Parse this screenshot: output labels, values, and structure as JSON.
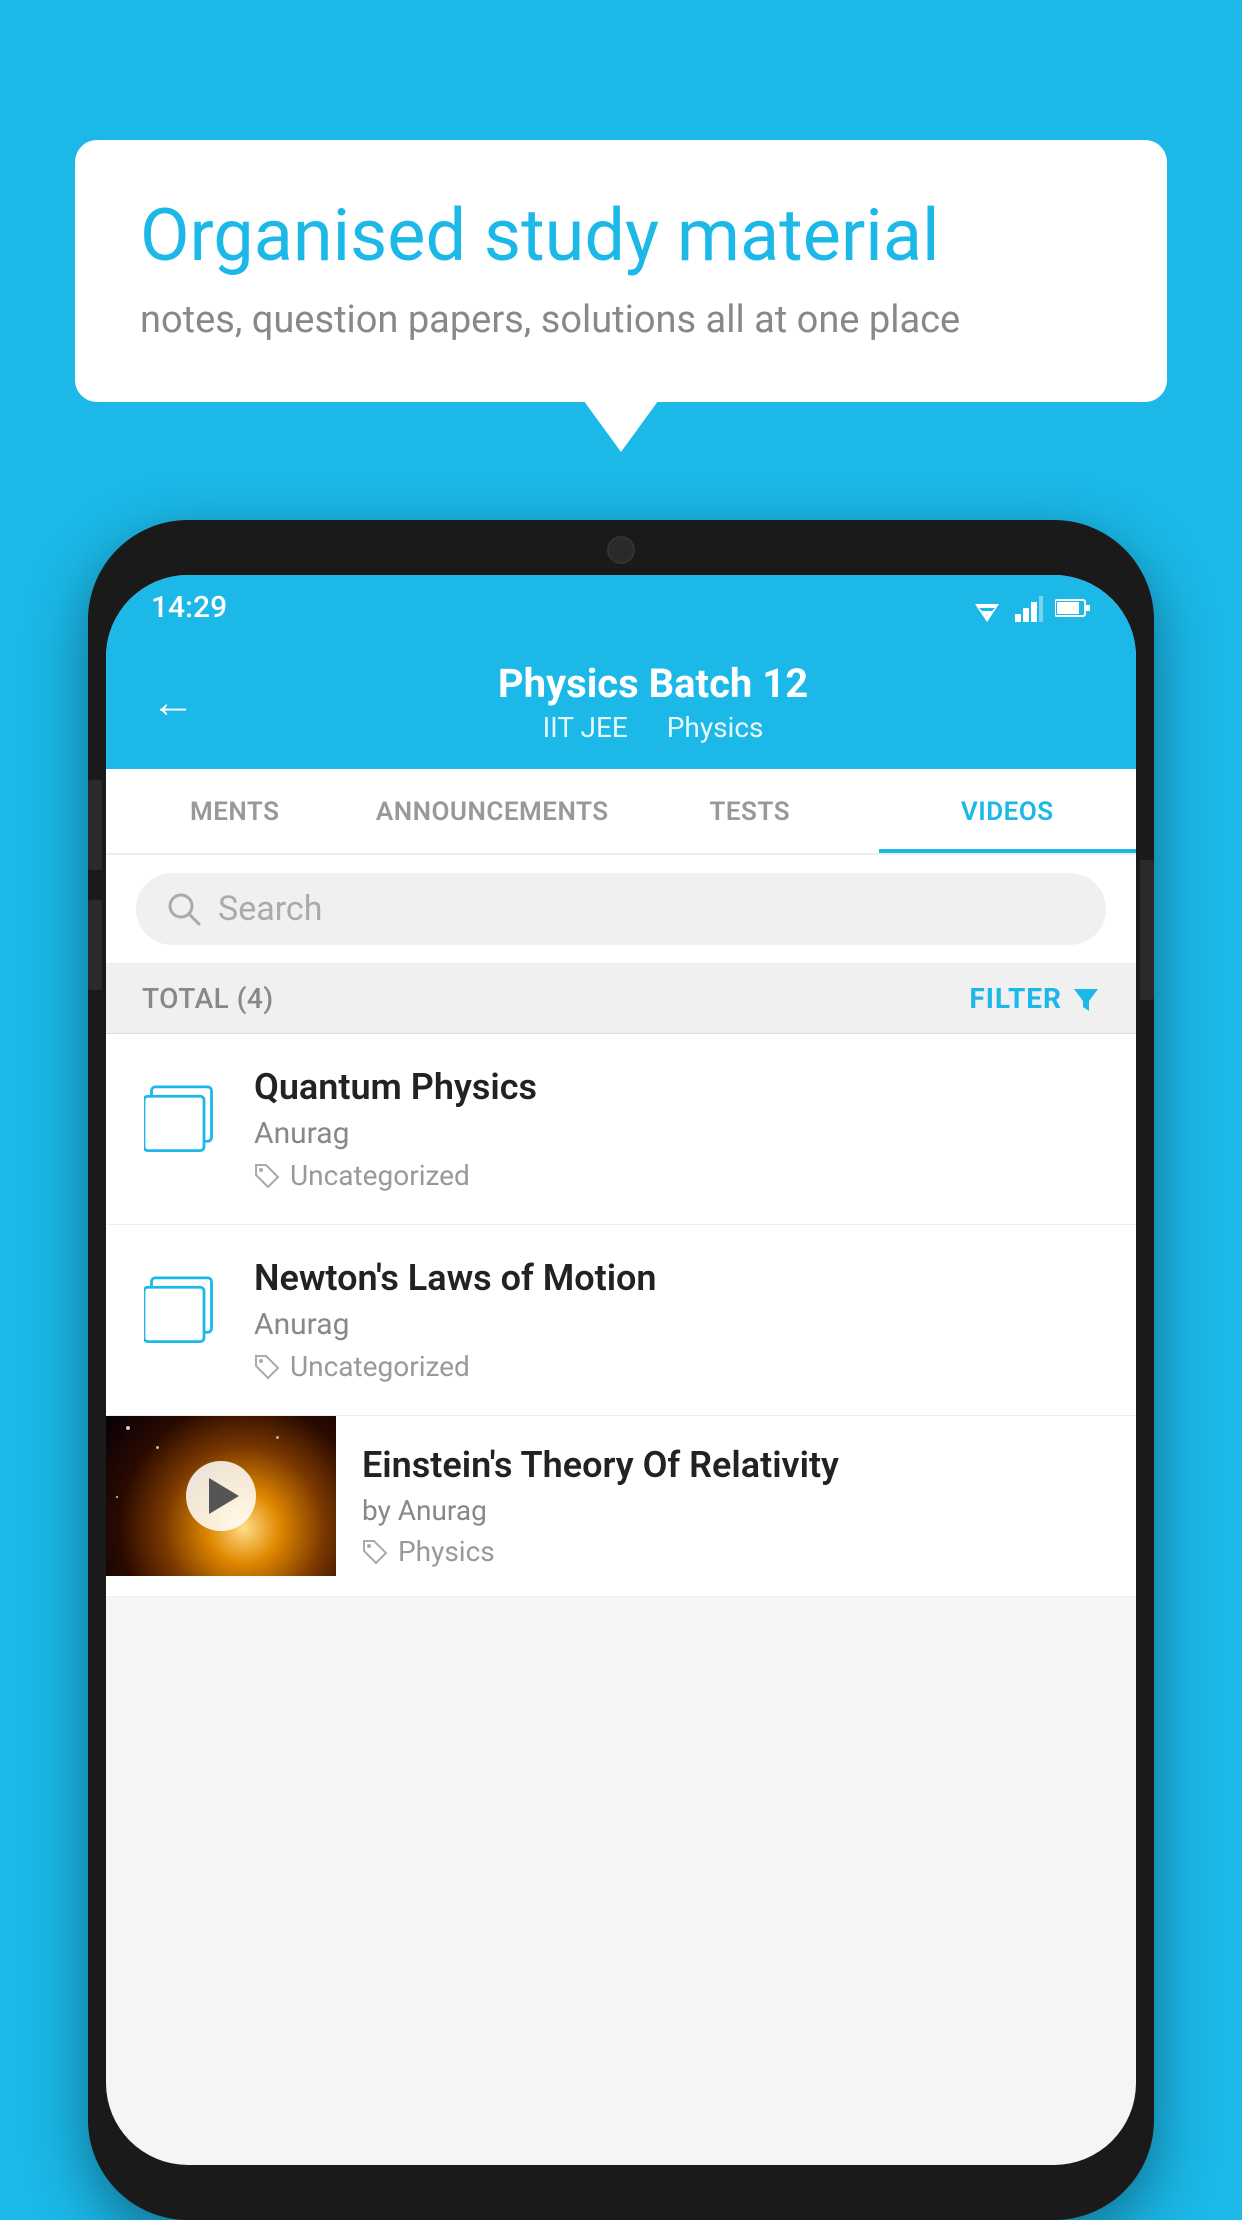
{
  "background_color": "#1bb8e8",
  "bubble": {
    "title": "Organised study material",
    "subtitle": "notes, question papers, solutions all at one place"
  },
  "phone": {
    "status_bar": {
      "time": "14:29",
      "wifi": "▲",
      "signal": "◀",
      "battery": "▮"
    },
    "header": {
      "back_label": "←",
      "title": "Physics Batch 12",
      "subtitle_left": "IIT JEE",
      "subtitle_right": "Physics"
    },
    "tabs": [
      {
        "label": "MENTS",
        "active": false
      },
      {
        "label": "ANNOUNCEMENTS",
        "active": false
      },
      {
        "label": "TESTS",
        "active": false
      },
      {
        "label": "VIDEOS",
        "active": true
      }
    ],
    "search": {
      "placeholder": "Search"
    },
    "filter_row": {
      "total_label": "TOTAL (4)",
      "filter_label": "FILTER"
    },
    "videos": [
      {
        "id": 1,
        "title": "Quantum Physics",
        "author": "Anurag",
        "tag": "Uncategorized",
        "has_thumb": false
      },
      {
        "id": 2,
        "title": "Newton's Laws of Motion",
        "author": "Anurag",
        "tag": "Uncategorized",
        "has_thumb": false
      },
      {
        "id": 3,
        "title": "Einstein's Theory Of Relativity",
        "author": "by Anurag",
        "tag": "Physics",
        "has_thumb": true
      }
    ]
  }
}
